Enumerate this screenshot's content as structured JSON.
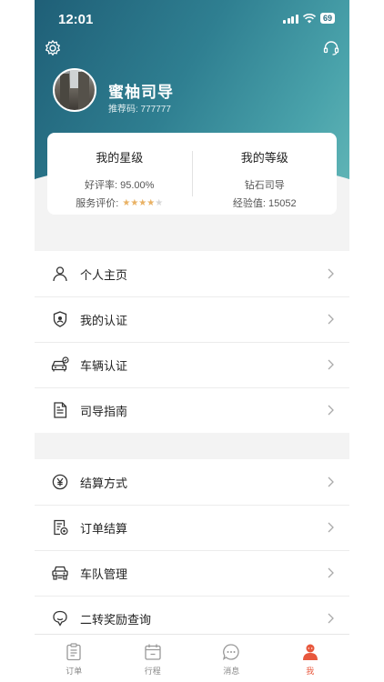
{
  "status_bar": {
    "time": "12:01",
    "battery": "69"
  },
  "profile": {
    "name": "蜜柚司导",
    "referral": "推荐码: 777777"
  },
  "stats": {
    "rating": {
      "title": "我的星级",
      "praise_rate": "好评率: 95.00%",
      "service_label": "服务评价:",
      "stars": 4,
      "max_stars": 5
    },
    "level": {
      "title": "我的等级",
      "level_name": "钻石司导",
      "experience": "经验值: 15052"
    }
  },
  "menu_group_1": [
    {
      "label": "个人主页",
      "icon": "person-icon"
    },
    {
      "label": "我的认证",
      "icon": "shield-icon"
    },
    {
      "label": "车辆认证",
      "icon": "car-verify-icon"
    },
    {
      "label": "司导指南",
      "icon": "document-icon"
    }
  ],
  "menu_group_2": [
    {
      "label": "结算方式",
      "icon": "yen-icon"
    },
    {
      "label": "订单结算",
      "icon": "order-settle-icon"
    },
    {
      "label": "车队管理",
      "icon": "fleet-icon"
    },
    {
      "label": "二转奖励查询",
      "icon": "reward-icon"
    }
  ],
  "tabbar": [
    {
      "label": "订单",
      "icon": "order-icon",
      "active": false
    },
    {
      "label": "行程",
      "icon": "calendar-icon",
      "active": false
    },
    {
      "label": "消息",
      "icon": "message-icon",
      "active": false
    },
    {
      "label": "我",
      "icon": "me-icon",
      "active": true
    }
  ],
  "colors": {
    "accent": "#e8583d",
    "header_start": "#1f5f77",
    "header_end": "#62b6b7",
    "star_on": "#e9b163"
  }
}
